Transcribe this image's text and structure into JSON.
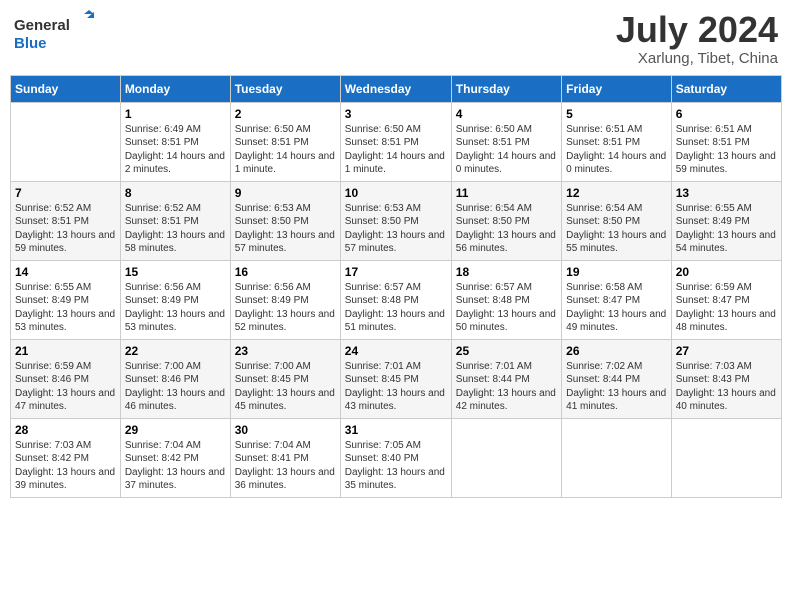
{
  "header": {
    "logo_line1": "General",
    "logo_line2": "Blue",
    "month_title": "July 2024",
    "subtitle": "Xarlung, Tibet, China"
  },
  "days_of_week": [
    "Sunday",
    "Monday",
    "Tuesday",
    "Wednesday",
    "Thursday",
    "Friday",
    "Saturday"
  ],
  "weeks": [
    [
      {
        "day": "",
        "sunrise": "",
        "sunset": "",
        "daylight": ""
      },
      {
        "day": "1",
        "sunrise": "Sunrise: 6:49 AM",
        "sunset": "Sunset: 8:51 PM",
        "daylight": "Daylight: 14 hours and 2 minutes."
      },
      {
        "day": "2",
        "sunrise": "Sunrise: 6:50 AM",
        "sunset": "Sunset: 8:51 PM",
        "daylight": "Daylight: 14 hours and 1 minute."
      },
      {
        "day": "3",
        "sunrise": "Sunrise: 6:50 AM",
        "sunset": "Sunset: 8:51 PM",
        "daylight": "Daylight: 14 hours and 1 minute."
      },
      {
        "day": "4",
        "sunrise": "Sunrise: 6:50 AM",
        "sunset": "Sunset: 8:51 PM",
        "daylight": "Daylight: 14 hours and 0 minutes."
      },
      {
        "day": "5",
        "sunrise": "Sunrise: 6:51 AM",
        "sunset": "Sunset: 8:51 PM",
        "daylight": "Daylight: 14 hours and 0 minutes."
      },
      {
        "day": "6",
        "sunrise": "Sunrise: 6:51 AM",
        "sunset": "Sunset: 8:51 PM",
        "daylight": "Daylight: 13 hours and 59 minutes."
      }
    ],
    [
      {
        "day": "7",
        "sunrise": "Sunrise: 6:52 AM",
        "sunset": "Sunset: 8:51 PM",
        "daylight": "Daylight: 13 hours and 59 minutes."
      },
      {
        "day": "8",
        "sunrise": "Sunrise: 6:52 AM",
        "sunset": "Sunset: 8:51 PM",
        "daylight": "Daylight: 13 hours and 58 minutes."
      },
      {
        "day": "9",
        "sunrise": "Sunrise: 6:53 AM",
        "sunset": "Sunset: 8:50 PM",
        "daylight": "Daylight: 13 hours and 57 minutes."
      },
      {
        "day": "10",
        "sunrise": "Sunrise: 6:53 AM",
        "sunset": "Sunset: 8:50 PM",
        "daylight": "Daylight: 13 hours and 57 minutes."
      },
      {
        "day": "11",
        "sunrise": "Sunrise: 6:54 AM",
        "sunset": "Sunset: 8:50 PM",
        "daylight": "Daylight: 13 hours and 56 minutes."
      },
      {
        "day": "12",
        "sunrise": "Sunrise: 6:54 AM",
        "sunset": "Sunset: 8:50 PM",
        "daylight": "Daylight: 13 hours and 55 minutes."
      },
      {
        "day": "13",
        "sunrise": "Sunrise: 6:55 AM",
        "sunset": "Sunset: 8:49 PM",
        "daylight": "Daylight: 13 hours and 54 minutes."
      }
    ],
    [
      {
        "day": "14",
        "sunrise": "Sunrise: 6:55 AM",
        "sunset": "Sunset: 8:49 PM",
        "daylight": "Daylight: 13 hours and 53 minutes."
      },
      {
        "day": "15",
        "sunrise": "Sunrise: 6:56 AM",
        "sunset": "Sunset: 8:49 PM",
        "daylight": "Daylight: 13 hours and 53 minutes."
      },
      {
        "day": "16",
        "sunrise": "Sunrise: 6:56 AM",
        "sunset": "Sunset: 8:49 PM",
        "daylight": "Daylight: 13 hours and 52 minutes."
      },
      {
        "day": "17",
        "sunrise": "Sunrise: 6:57 AM",
        "sunset": "Sunset: 8:48 PM",
        "daylight": "Daylight: 13 hours and 51 minutes."
      },
      {
        "day": "18",
        "sunrise": "Sunrise: 6:57 AM",
        "sunset": "Sunset: 8:48 PM",
        "daylight": "Daylight: 13 hours and 50 minutes."
      },
      {
        "day": "19",
        "sunrise": "Sunrise: 6:58 AM",
        "sunset": "Sunset: 8:47 PM",
        "daylight": "Daylight: 13 hours and 49 minutes."
      },
      {
        "day": "20",
        "sunrise": "Sunrise: 6:59 AM",
        "sunset": "Sunset: 8:47 PM",
        "daylight": "Daylight: 13 hours and 48 minutes."
      }
    ],
    [
      {
        "day": "21",
        "sunrise": "Sunrise: 6:59 AM",
        "sunset": "Sunset: 8:46 PM",
        "daylight": "Daylight: 13 hours and 47 minutes."
      },
      {
        "day": "22",
        "sunrise": "Sunrise: 7:00 AM",
        "sunset": "Sunset: 8:46 PM",
        "daylight": "Daylight: 13 hours and 46 minutes."
      },
      {
        "day": "23",
        "sunrise": "Sunrise: 7:00 AM",
        "sunset": "Sunset: 8:45 PM",
        "daylight": "Daylight: 13 hours and 45 minutes."
      },
      {
        "day": "24",
        "sunrise": "Sunrise: 7:01 AM",
        "sunset": "Sunset: 8:45 PM",
        "daylight": "Daylight: 13 hours and 43 minutes."
      },
      {
        "day": "25",
        "sunrise": "Sunrise: 7:01 AM",
        "sunset": "Sunset: 8:44 PM",
        "daylight": "Daylight: 13 hours and 42 minutes."
      },
      {
        "day": "26",
        "sunrise": "Sunrise: 7:02 AM",
        "sunset": "Sunset: 8:44 PM",
        "daylight": "Daylight: 13 hours and 41 minutes."
      },
      {
        "day": "27",
        "sunrise": "Sunrise: 7:03 AM",
        "sunset": "Sunset: 8:43 PM",
        "daylight": "Daylight: 13 hours and 40 minutes."
      }
    ],
    [
      {
        "day": "28",
        "sunrise": "Sunrise: 7:03 AM",
        "sunset": "Sunset: 8:42 PM",
        "daylight": "Daylight: 13 hours and 39 minutes."
      },
      {
        "day": "29",
        "sunrise": "Sunrise: 7:04 AM",
        "sunset": "Sunset: 8:42 PM",
        "daylight": "Daylight: 13 hours and 37 minutes."
      },
      {
        "day": "30",
        "sunrise": "Sunrise: 7:04 AM",
        "sunset": "Sunset: 8:41 PM",
        "daylight": "Daylight: 13 hours and 36 minutes."
      },
      {
        "day": "31",
        "sunrise": "Sunrise: 7:05 AM",
        "sunset": "Sunset: 8:40 PM",
        "daylight": "Daylight: 13 hours and 35 minutes."
      },
      {
        "day": "",
        "sunrise": "",
        "sunset": "",
        "daylight": ""
      },
      {
        "day": "",
        "sunrise": "",
        "sunset": "",
        "daylight": ""
      },
      {
        "day": "",
        "sunrise": "",
        "sunset": "",
        "daylight": ""
      }
    ]
  ]
}
